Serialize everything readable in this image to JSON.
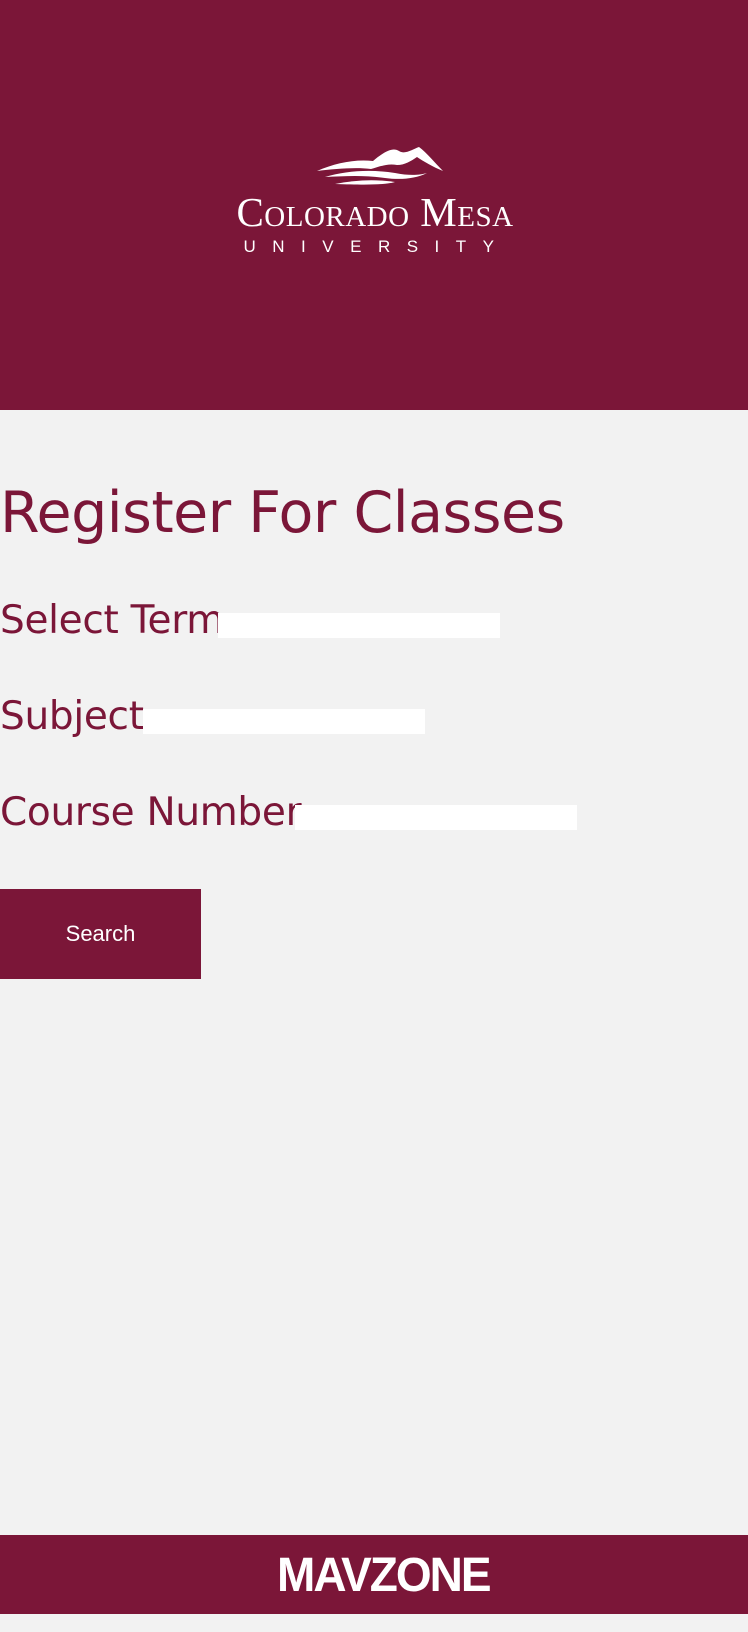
{
  "header": {
    "logo_name": "Colorado Mesa",
    "logo_subtitle": "UNIVERSITY"
  },
  "main": {
    "title": "Register For Classes",
    "fields": [
      {
        "label": "Select Term",
        "value": ""
      },
      {
        "label": "Subject",
        "value": ""
      },
      {
        "label": "Course Number",
        "value": ""
      }
    ],
    "search_label": "Search"
  },
  "footer": {
    "logo_text": "MAVZONE"
  },
  "colors": {
    "brand": "#7b1638",
    "background": "#f2f2f2",
    "input": "#ffffff",
    "text_on_brand": "#ffffff"
  }
}
